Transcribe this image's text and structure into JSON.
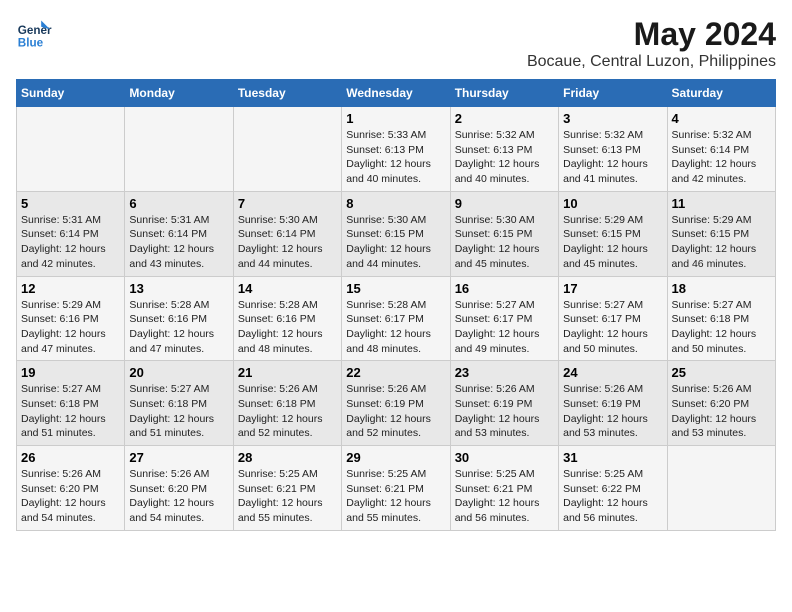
{
  "header": {
    "logo_line1": "General",
    "logo_line2": "Blue",
    "title": "May 2024",
    "subtitle": "Bocaue, Central Luzon, Philippines"
  },
  "columns": [
    "Sunday",
    "Monday",
    "Tuesday",
    "Wednesday",
    "Thursday",
    "Friday",
    "Saturday"
  ],
  "weeks": [
    [
      {
        "day": "",
        "info": ""
      },
      {
        "day": "",
        "info": ""
      },
      {
        "day": "",
        "info": ""
      },
      {
        "day": "1",
        "info": "Sunrise: 5:33 AM\nSunset: 6:13 PM\nDaylight: 12 hours and 40 minutes."
      },
      {
        "day": "2",
        "info": "Sunrise: 5:32 AM\nSunset: 6:13 PM\nDaylight: 12 hours and 40 minutes."
      },
      {
        "day": "3",
        "info": "Sunrise: 5:32 AM\nSunset: 6:13 PM\nDaylight: 12 hours and 41 minutes."
      },
      {
        "day": "4",
        "info": "Sunrise: 5:32 AM\nSunset: 6:14 PM\nDaylight: 12 hours and 42 minutes."
      }
    ],
    [
      {
        "day": "5",
        "info": "Sunrise: 5:31 AM\nSunset: 6:14 PM\nDaylight: 12 hours and 42 minutes."
      },
      {
        "day": "6",
        "info": "Sunrise: 5:31 AM\nSunset: 6:14 PM\nDaylight: 12 hours and 43 minutes."
      },
      {
        "day": "7",
        "info": "Sunrise: 5:30 AM\nSunset: 6:14 PM\nDaylight: 12 hours and 44 minutes."
      },
      {
        "day": "8",
        "info": "Sunrise: 5:30 AM\nSunset: 6:15 PM\nDaylight: 12 hours and 44 minutes."
      },
      {
        "day": "9",
        "info": "Sunrise: 5:30 AM\nSunset: 6:15 PM\nDaylight: 12 hours and 45 minutes."
      },
      {
        "day": "10",
        "info": "Sunrise: 5:29 AM\nSunset: 6:15 PM\nDaylight: 12 hours and 45 minutes."
      },
      {
        "day": "11",
        "info": "Sunrise: 5:29 AM\nSunset: 6:15 PM\nDaylight: 12 hours and 46 minutes."
      }
    ],
    [
      {
        "day": "12",
        "info": "Sunrise: 5:29 AM\nSunset: 6:16 PM\nDaylight: 12 hours and 47 minutes."
      },
      {
        "day": "13",
        "info": "Sunrise: 5:28 AM\nSunset: 6:16 PM\nDaylight: 12 hours and 47 minutes."
      },
      {
        "day": "14",
        "info": "Sunrise: 5:28 AM\nSunset: 6:16 PM\nDaylight: 12 hours and 48 minutes."
      },
      {
        "day": "15",
        "info": "Sunrise: 5:28 AM\nSunset: 6:17 PM\nDaylight: 12 hours and 48 minutes."
      },
      {
        "day": "16",
        "info": "Sunrise: 5:27 AM\nSunset: 6:17 PM\nDaylight: 12 hours and 49 minutes."
      },
      {
        "day": "17",
        "info": "Sunrise: 5:27 AM\nSunset: 6:17 PM\nDaylight: 12 hours and 50 minutes."
      },
      {
        "day": "18",
        "info": "Sunrise: 5:27 AM\nSunset: 6:18 PM\nDaylight: 12 hours and 50 minutes."
      }
    ],
    [
      {
        "day": "19",
        "info": "Sunrise: 5:27 AM\nSunset: 6:18 PM\nDaylight: 12 hours and 51 minutes."
      },
      {
        "day": "20",
        "info": "Sunrise: 5:27 AM\nSunset: 6:18 PM\nDaylight: 12 hours and 51 minutes."
      },
      {
        "day": "21",
        "info": "Sunrise: 5:26 AM\nSunset: 6:18 PM\nDaylight: 12 hours and 52 minutes."
      },
      {
        "day": "22",
        "info": "Sunrise: 5:26 AM\nSunset: 6:19 PM\nDaylight: 12 hours and 52 minutes."
      },
      {
        "day": "23",
        "info": "Sunrise: 5:26 AM\nSunset: 6:19 PM\nDaylight: 12 hours and 53 minutes."
      },
      {
        "day": "24",
        "info": "Sunrise: 5:26 AM\nSunset: 6:19 PM\nDaylight: 12 hours and 53 minutes."
      },
      {
        "day": "25",
        "info": "Sunrise: 5:26 AM\nSunset: 6:20 PM\nDaylight: 12 hours and 53 minutes."
      }
    ],
    [
      {
        "day": "26",
        "info": "Sunrise: 5:26 AM\nSunset: 6:20 PM\nDaylight: 12 hours and 54 minutes."
      },
      {
        "day": "27",
        "info": "Sunrise: 5:26 AM\nSunset: 6:20 PM\nDaylight: 12 hours and 54 minutes."
      },
      {
        "day": "28",
        "info": "Sunrise: 5:25 AM\nSunset: 6:21 PM\nDaylight: 12 hours and 55 minutes."
      },
      {
        "day": "29",
        "info": "Sunrise: 5:25 AM\nSunset: 6:21 PM\nDaylight: 12 hours and 55 minutes."
      },
      {
        "day": "30",
        "info": "Sunrise: 5:25 AM\nSunset: 6:21 PM\nDaylight: 12 hours and 56 minutes."
      },
      {
        "day": "31",
        "info": "Sunrise: 5:25 AM\nSunset: 6:22 PM\nDaylight: 12 hours and 56 minutes."
      },
      {
        "day": "",
        "info": ""
      }
    ]
  ]
}
